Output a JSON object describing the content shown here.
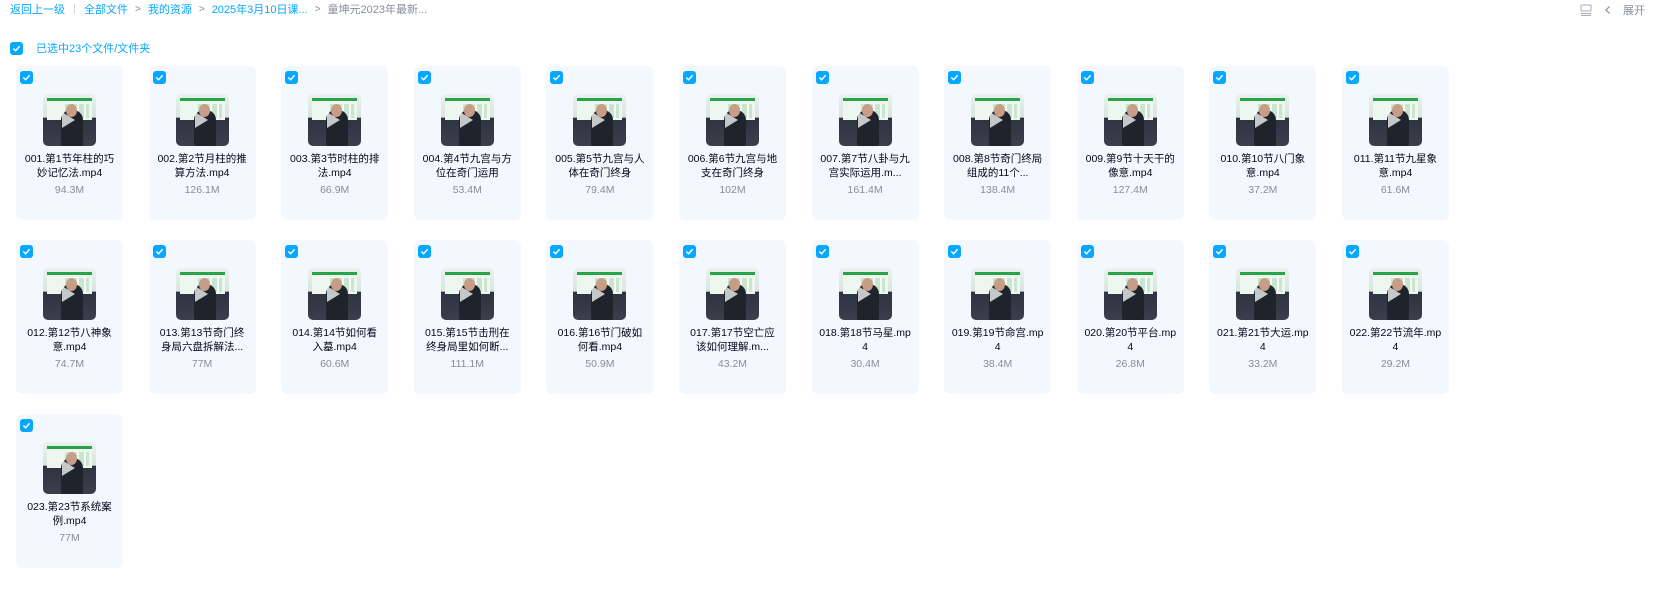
{
  "breadcrumb": {
    "back": "返回上一级",
    "items": [
      "全部文件",
      "我的资源",
      "2025年3月10日课...",
      "童坤元2023年最新..."
    ]
  },
  "toolbar": {
    "expand_label": "展开",
    "icons": [
      "list-view-icon",
      "chevron-left-icon"
    ]
  },
  "selection": {
    "text": "已选中23个文件/文件夹",
    "checked": true
  },
  "colors": {
    "accent": "#06a7ff",
    "card_bg": "#f3f8fe",
    "muted": "#878c9c"
  },
  "files": [
    {
      "name": "001.第1节年柱的巧妙记忆法.mp4",
      "size": "94.3M"
    },
    {
      "name": "002.第2节月柱的推算方法.mp4",
      "size": "126.1M"
    },
    {
      "name": "003.第3节时柱的排法.mp4",
      "size": "66.9M"
    },
    {
      "name": "004.第4节九宫与方位在奇门运用",
      "size": "53.4M"
    },
    {
      "name": "005.第5节九宫与人体在奇门终身",
      "size": "79.4M"
    },
    {
      "name": "006.第6节九宫与地支在奇门终身",
      "size": "102M"
    },
    {
      "name": "007.第7节八卦与九宫实际运用.m...",
      "size": "161.4M"
    },
    {
      "name": "008.第8节奇门终局组成的11个...",
      "size": "138.4M"
    },
    {
      "name": "009.第9节十天干的像意.mp4",
      "size": "127.4M"
    },
    {
      "name": "010.第10节八门象意.mp4",
      "size": "37.2M"
    },
    {
      "name": "011.第11节九星象意.mp4",
      "size": "61.6M"
    },
    {
      "name": "012.第12节八神象意.mp4",
      "size": "74.7M"
    },
    {
      "name": "013.第13节奇门终身局六盘拆解法...",
      "size": "77M"
    },
    {
      "name": "014.第14节如何看入墓.mp4",
      "size": "60.6M"
    },
    {
      "name": "015.第15节击刑在终身局里如何断...",
      "size": "111.1M"
    },
    {
      "name": "016.第16节门破如何看.mp4",
      "size": "50.9M"
    },
    {
      "name": "017.第17节空亡应该如何理解.m...",
      "size": "43.2M"
    },
    {
      "name": "018.第18节马星.mp4",
      "size": "30.4M"
    },
    {
      "name": "019.第19节命宫.mp4",
      "size": "38.4M"
    },
    {
      "name": "020.第20节平台.mp4",
      "size": "26.8M"
    },
    {
      "name": "021.第21节大运.mp4",
      "size": "33.2M"
    },
    {
      "name": "022.第22节流年.mp4",
      "size": "29.2M"
    },
    {
      "name": "023.第23节系统案例.mp4",
      "size": "77M"
    }
  ]
}
